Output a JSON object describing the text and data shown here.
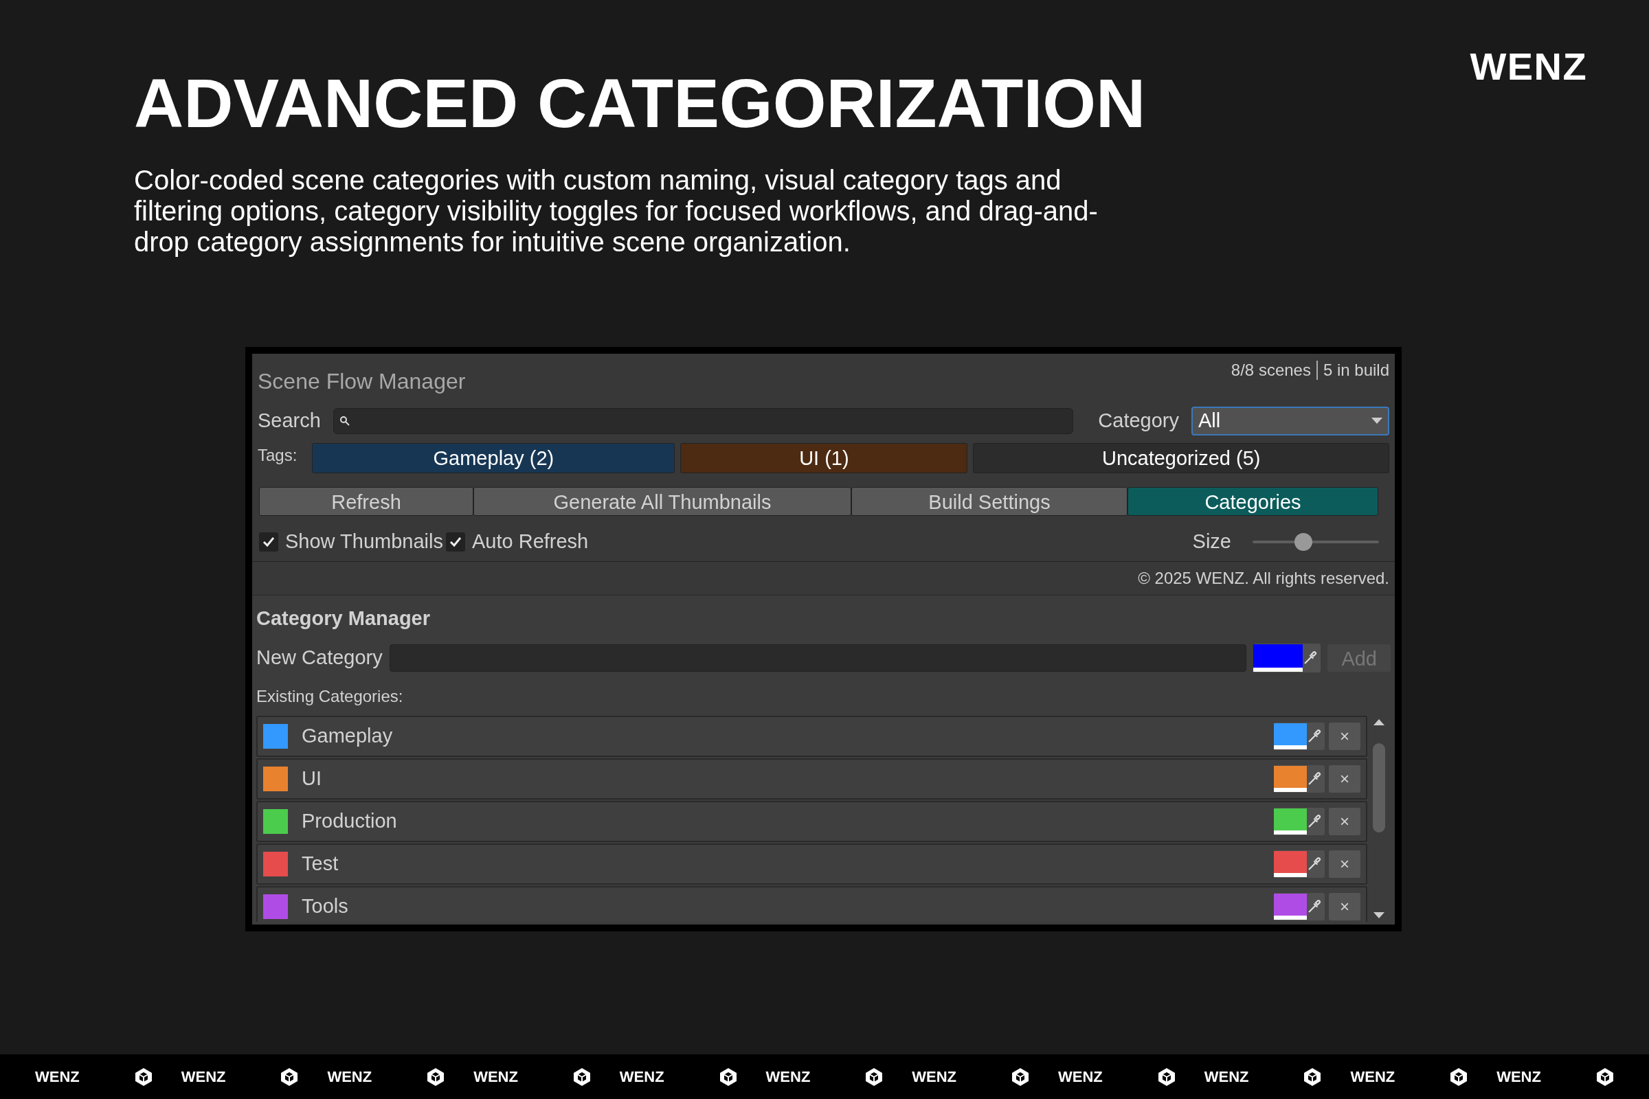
{
  "logo": "WENZ",
  "headline": "ADVANCED CATEGORIZATION",
  "description": "Color-coded scene categories with custom naming, visual category tags and filtering options, category visibility toggles for focused workflows, and drag-and-drop category assignments for intuitive scene organization.",
  "window": {
    "title": "Scene Flow Manager",
    "scene_count": "8/8 scenes",
    "build_count": "5 in build",
    "search": {
      "label": "Search"
    },
    "category_filter": {
      "label": "Category",
      "value": "All"
    },
    "tags_label": "Tags:",
    "tags": [
      {
        "label": "Gameplay (2)",
        "color": "#173654"
      },
      {
        "label": "UI (1)",
        "color": "#4d2a12"
      },
      {
        "label": "Uncategorized (5)",
        "color": "#2c2c2c"
      }
    ],
    "toolbar": [
      {
        "label": "Refresh",
        "selected": false
      },
      {
        "label": "Generate All Thumbnails",
        "selected": false
      },
      {
        "label": "Build Settings",
        "selected": false
      },
      {
        "label": "Categories",
        "selected": true
      }
    ],
    "options": [
      {
        "label": "Show Thumbnails",
        "checked": true
      },
      {
        "label": "Auto Refresh",
        "checked": true
      }
    ],
    "size": {
      "label": "Size",
      "level": 0.4
    },
    "copyright": "© 2025 WENZ. All rights reserved.",
    "category_manager": {
      "title": "Category Manager",
      "new_label": "New Category",
      "new_category": {
        "color": "#0000ff"
      },
      "add_button": "Add",
      "existing_label": "Existing Categories:",
      "categories": [
        {
          "name": "Gameplay",
          "color": "#3399ff"
        },
        {
          "name": "UI",
          "color": "#e8822f"
        },
        {
          "name": "Production",
          "color": "#4ccc4c"
        },
        {
          "name": "Test",
          "color": "#e64c4c"
        },
        {
          "name": "Tools",
          "color": "#b04ce6"
        }
      ],
      "remove_label": "×"
    }
  },
  "footer": [
    "WENZ",
    "WENZ",
    "WENZ",
    "WENZ",
    "WENZ",
    "WENZ",
    "WENZ",
    "WENZ",
    "WENZ",
    "WENZ",
    "WENZ"
  ]
}
